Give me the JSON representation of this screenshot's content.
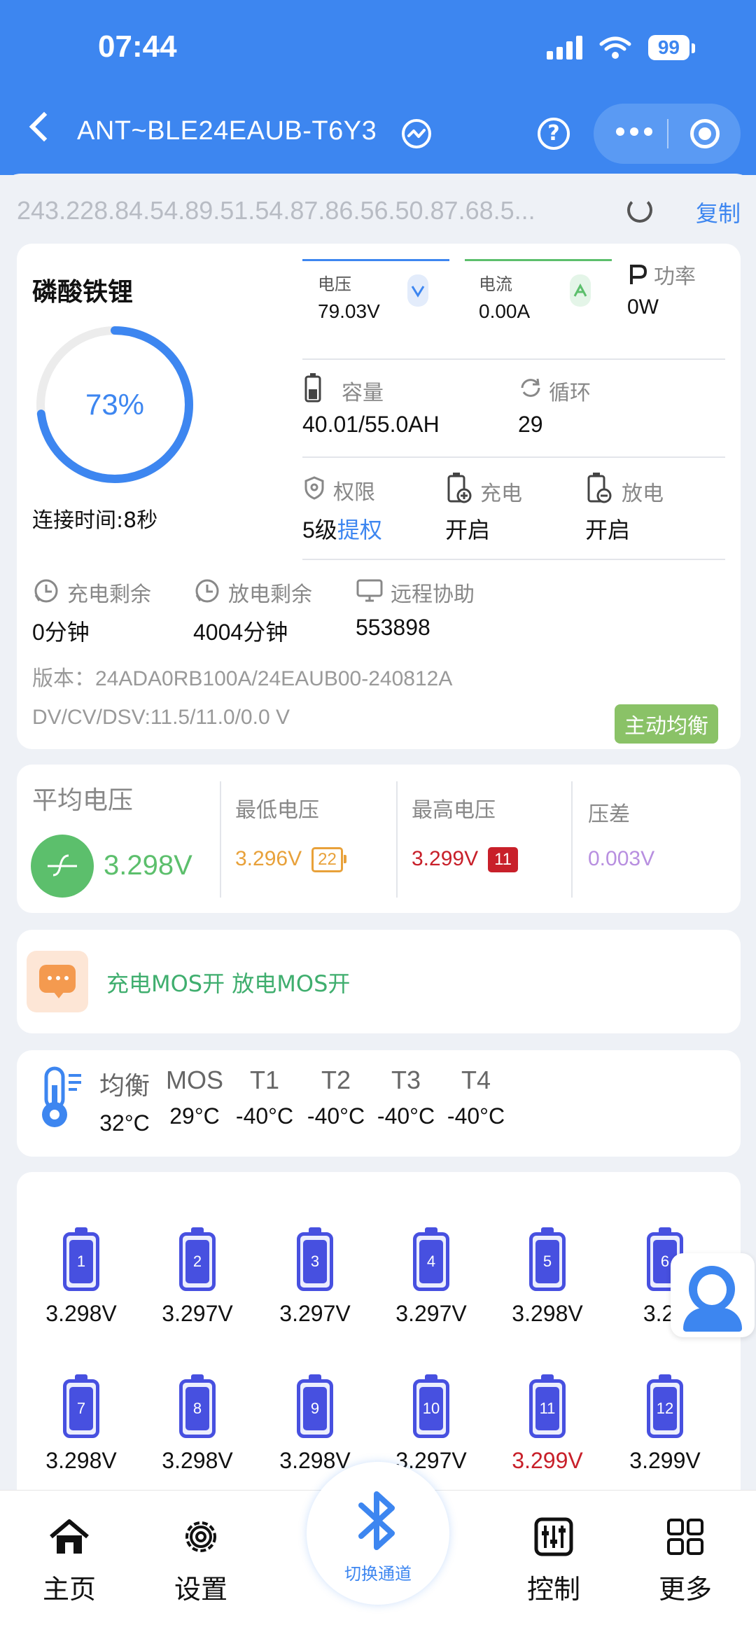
{
  "status": {
    "time": "07:44",
    "battery": "99"
  },
  "header": {
    "title": "ANT~BLE24EAUB-T6Y3"
  },
  "mac": {
    "text": "243.228.84.54.89.51.54.87.86.56.50.87.68.5...",
    "copy_label": "复制"
  },
  "main": {
    "chemistry": "磷酸铁锂",
    "soc": 73,
    "soc_label": "73%",
    "connect_time": "连接时间:8秒",
    "voltage": {
      "label": "电压",
      "value": "79.03V"
    },
    "current": {
      "label": "电流",
      "value": "0.00A"
    },
    "power": {
      "label": "功率",
      "value": "0W"
    },
    "capacity": {
      "label": "容量",
      "value": "40.01/55.0AH"
    },
    "cycle": {
      "label": "循环",
      "value": "29"
    },
    "permission": {
      "label": "权限",
      "value_prefix": "5级",
      "value_link": "提权"
    },
    "charge": {
      "label": "充电",
      "value": "开启"
    },
    "discharge": {
      "label": "放电",
      "value": "开启"
    },
    "charge_remain": {
      "label": "充电剩余",
      "value": "0分钟"
    },
    "discharge_remain": {
      "label": "放电剩余",
      "value": "4004分钟"
    },
    "remote": {
      "label": "远程协助",
      "value": "553898"
    },
    "version": "版本：24ADA0RB100A/24EAUB00-240812A",
    "dvcv": "DV/CV/DSV:11.5/11.0/0.0 V",
    "balance_tag": "主动均衡",
    "colors": {
      "accent": "#3d86f0",
      "voltage_bar": "#3d86f0",
      "current_bar": "#5cbf6c"
    }
  },
  "voltages": {
    "avg": {
      "label": "平均电压",
      "value": "3.298V",
      "color": "#5cbf6c"
    },
    "min": {
      "label": "最低电压",
      "value": "3.296V",
      "cell": "22",
      "color": "#e8a13a"
    },
    "max": {
      "label": "最高电压",
      "value": "3.299V",
      "cell": "11",
      "color": "#c8202a"
    },
    "diff": {
      "label": "压差",
      "value": "0.003V",
      "color": "#b88fe0"
    }
  },
  "mos": {
    "text": "充电MOS开  放电MOS开"
  },
  "temps": [
    {
      "label": "均衡",
      "value": "32°C"
    },
    {
      "label": "MOS",
      "value": "29°C"
    },
    {
      "label": "T1",
      "value": "-40°C"
    },
    {
      "label": "T2",
      "value": "-40°C"
    },
    {
      "label": "T3",
      "value": "-40°C"
    },
    {
      "label": "T4",
      "value": "-40°C"
    }
  ],
  "cells": [
    {
      "n": "1",
      "v": "3.298V"
    },
    {
      "n": "2",
      "v": "3.297V"
    },
    {
      "n": "3",
      "v": "3.297V"
    },
    {
      "n": "4",
      "v": "3.297V"
    },
    {
      "n": "5",
      "v": "3.298V"
    },
    {
      "n": "6",
      "v": "3.29"
    },
    {
      "n": "7",
      "v": "3.298V"
    },
    {
      "n": "8",
      "v": "3.298V"
    },
    {
      "n": "9",
      "v": "3.298V"
    },
    {
      "n": "10",
      "v": "3.297V"
    },
    {
      "n": "11",
      "v": "3.299V"
    },
    {
      "n": "12",
      "v": "3.299V"
    }
  ],
  "nav": {
    "home": "主页",
    "settings": "设置",
    "switch": "切换通道",
    "control": "控制",
    "more": "更多"
  }
}
